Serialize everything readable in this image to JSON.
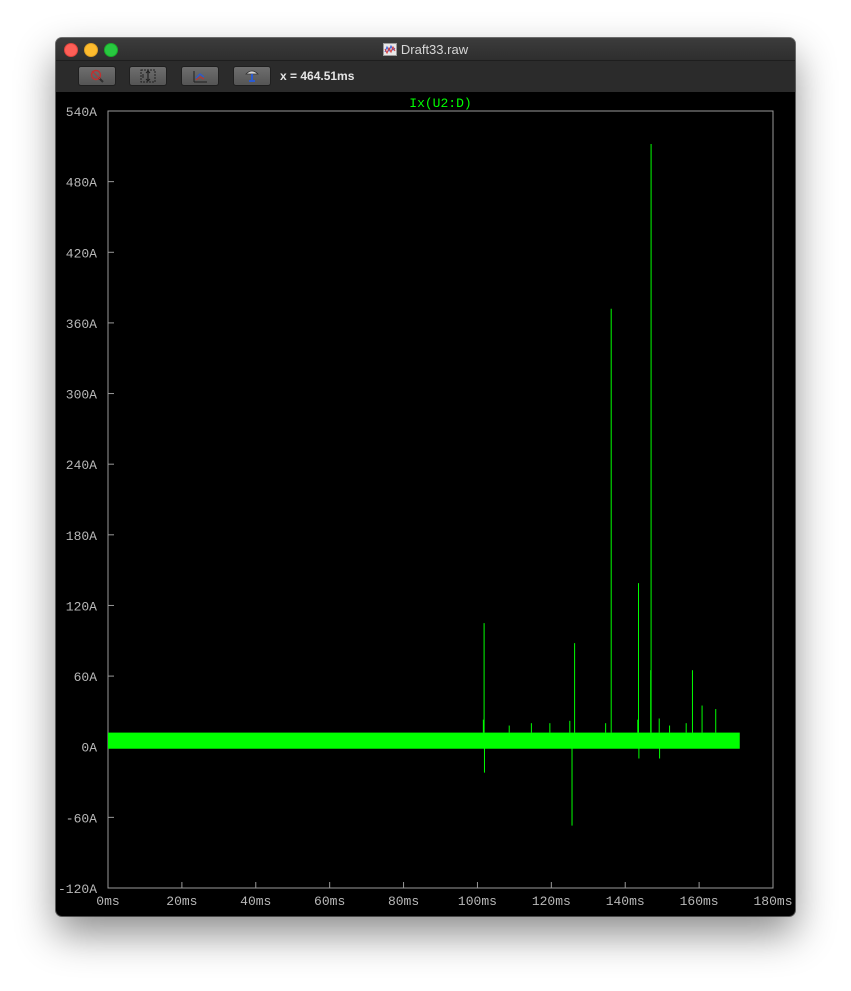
{
  "window": {
    "title": "Draft33.raw",
    "cursor_readout": "x = 464.51ms",
    "toolbar_icons": [
      "zoom-to-fit-icon",
      "autorange-y-icon",
      "autorange-x-icon",
      "plot-settings-icon"
    ]
  },
  "colors": {
    "trace": "#00ff00",
    "axis": "#9a9a9a",
    "tick_label": "#b8b8b8",
    "background": "#000000"
  },
  "chart_data": {
    "type": "line",
    "title": "Ix(U2:D)",
    "xlabel": "",
    "ylabel": "",
    "xlim": [
      0,
      180
    ],
    "ylim": [
      -120,
      540
    ],
    "x_ticks": [
      "0ms",
      "20ms",
      "40ms",
      "60ms",
      "80ms",
      "100ms",
      "120ms",
      "140ms",
      "160ms",
      "180ms"
    ],
    "y_ticks": [
      "540A",
      "480A",
      "420A",
      "360A",
      "300A",
      "240A",
      "180A",
      "120A",
      "60A",
      "0A",
      "-60A",
      "-120A"
    ],
    "grid": false,
    "series": [
      {
        "name": "Ix(U2:D)",
        "band": {
          "x_start": 0,
          "x_end": 171,
          "y_low": 0,
          "y_high": 12
        },
        "spikes": [
          {
            "x": 101.8,
            "y": 105
          },
          {
            "x": 101.9,
            "y": -22
          },
          {
            "x": 101.6,
            "y": 23
          },
          {
            "x": 108.6,
            "y": 18
          },
          {
            "x": 114.6,
            "y": 20
          },
          {
            "x": 119.6,
            "y": 20
          },
          {
            "x": 125.0,
            "y": 22
          },
          {
            "x": 125.6,
            "y": -67
          },
          {
            "x": 126.3,
            "y": 88
          },
          {
            "x": 134.7,
            "y": 20
          },
          {
            "x": 136.2,
            "y": 372
          },
          {
            "x": 143.4,
            "y": 23
          },
          {
            "x": 143.6,
            "y": 139
          },
          {
            "x": 143.7,
            "y": -10
          },
          {
            "x": 147.0,
            "y": 512
          },
          {
            "x": 146.9,
            "y": 65
          },
          {
            "x": 149.2,
            "y": 24
          },
          {
            "x": 149.3,
            "y": -10
          },
          {
            "x": 152.0,
            "y": 18
          },
          {
            "x": 156.5,
            "y": 20
          },
          {
            "x": 158.2,
            "y": 65
          },
          {
            "x": 160.8,
            "y": 35
          },
          {
            "x": 164.5,
            "y": 32
          }
        ]
      }
    ]
  }
}
